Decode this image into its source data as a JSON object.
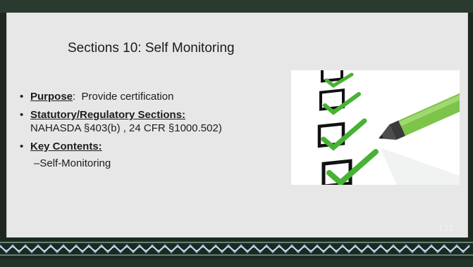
{
  "slide": {
    "title": "Sections 10: Self Monitoring",
    "page_number": "122",
    "bullets": [
      {
        "head": "Purpose",
        "sep": ":  ",
        "text": "Provide certification"
      },
      {
        "head": "Statutory/Regulatory Sections:",
        "text": "NAHASDA §403(b) , 24 CFR §1000.502)"
      },
      {
        "head": "Key Contents:",
        "text": ""
      }
    ],
    "sub_bullets": [
      {
        "dash": "–",
        "text": "Self-Monitoring"
      }
    ],
    "image": {
      "icon": "checklist-pen-icon"
    },
    "colors": {
      "panel": "#e6e7e6",
      "frame": "#1e2820",
      "zigzag": "#7fa4cf",
      "check_green": "#47b233"
    }
  }
}
